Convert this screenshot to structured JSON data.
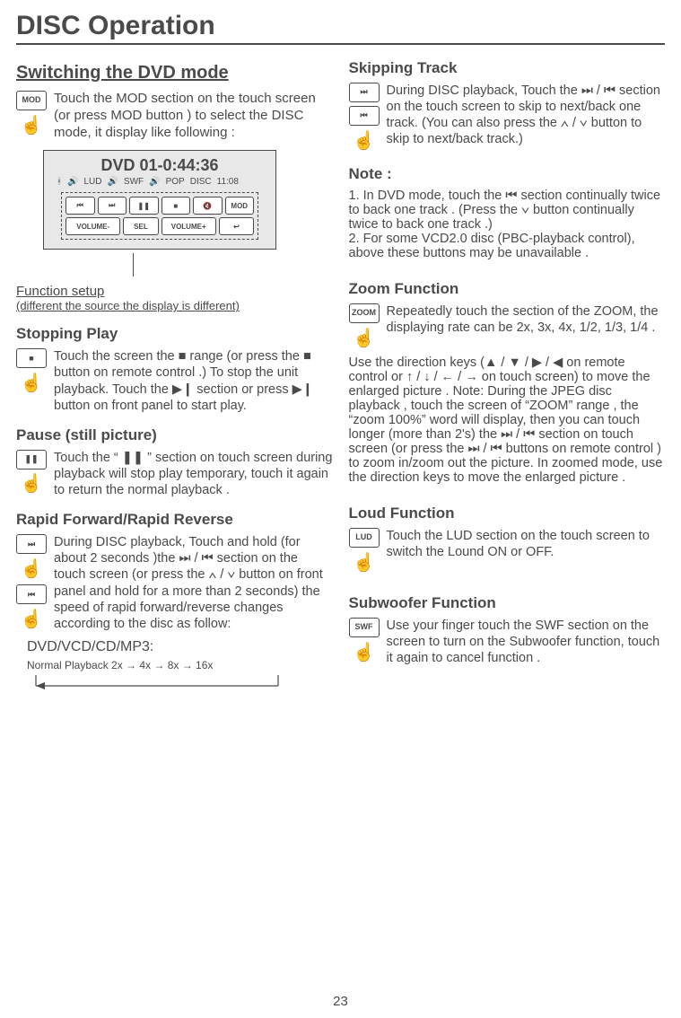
{
  "page_title": "DISC Operation",
  "page_number": "23",
  "left": {
    "switching_heading": "Switching the DVD mode",
    "switching_body": "Touch the MOD section on the touch screen (or press MOD button ) to select the DISC mode, it display like following :",
    "display": {
      "title": "DVD    01-0:44:36",
      "status": {
        "lud": "LUD",
        "swf": "SWF",
        "pop": "POP",
        "disc": "DISC",
        "time": "11:08"
      },
      "row1": [
        "⏮",
        "⏭",
        "❚❚",
        "■",
        "🔇",
        "MOD"
      ],
      "row2": [
        "VOLUME-",
        "SEL",
        "VOLUME+",
        "↩"
      ]
    },
    "func_setup": "Function setup",
    "func_setup_sub": "(different the source the display is different)",
    "stopping_heading": "Stopping Play",
    "stopping_body": "Touch the screen the ■ range (or press the ■ button on remote control .) To stop the unit playback. Touch the ▶❙ section or press ▶❙ button on front panel to start play.",
    "pause_heading": "Pause (still picture)",
    "pause_body": "Touch the “ ❚❚ ” section on touch screen during playback will stop play temporary, touch it again to return the normal playback .",
    "rapid_heading": "Rapid Forward/Rapid Reverse",
    "rapid_body": "During DISC playback, Touch and hold (for about 2 seconds )the ⏭ / ⏮  section on the touch screen (or press the  ∧ / ∨  button on front panel and hold for a more than 2 seconds) the speed of rapid forward/reverse changes according to the disc as follow:",
    "speed_heading": "DVD/VCD/CD/MP3:",
    "speed_line": "Normal Playback 2x →  4x →  8x → 16x"
  },
  "right": {
    "skipping_heading": "Skipping Track",
    "skipping_body": "During DISC playback, Touch the ⏭ / ⏮ section on the touch screen to skip to next/back one track. (You can also press the  ∧  /  ∨ button to skip to next/back track.)",
    "note_heading": "Note :",
    "note_body": "1. In DVD mode, touch the  ⏮  section continually twice to back one track . (Press the  ∨  button continually twice to back one track .)\n2. For some VCD2.0 disc (PBC-playback control), above these buttons may be unavailable .",
    "zoom_heading": "Zoom Function",
    "zoom_body1": "Repeatedly touch the section of the ZOOM, the displaying rate can be 2x, 3x, 4x, 1/2, 1/3, 1/4 .",
    "zoom_body2": "Use the direction keys (▲ / ▼ / ▶ / ◀  on remote control or  ↑ /  ↓ / ← / →  on touch screen) to move the enlarged picture . Note: During the JPEG disc playback , touch the screen of  “ZOOM” range , the “zoom 100%”  word will display, then you can touch longer (more than 2's) the ⏭ / ⏮  section on touch screen (or press the ⏭  / ⏮  buttons on remote control )  to zoom in/zoom out the picture. In zoomed mode, use the direction keys to move the enlarged picture .",
    "loud_heading": "Loud Function",
    "loud_body": "Touch the LUD section on the touch screen to switch the Lound ON or OFF.",
    "sub_heading": "Subwoofer Function",
    "sub_body": "Use your finger touch the SWF section on the screen to turn on the Subwoofer  function, touch it again to cancel function ."
  },
  "labels": {
    "mod": "MOD",
    "zoom": "ZOOM",
    "lud": "LUD",
    "swf": "SWF",
    "next": "⏭",
    "prev": "⏮",
    "pause": "❚❚",
    "stop": "■"
  }
}
